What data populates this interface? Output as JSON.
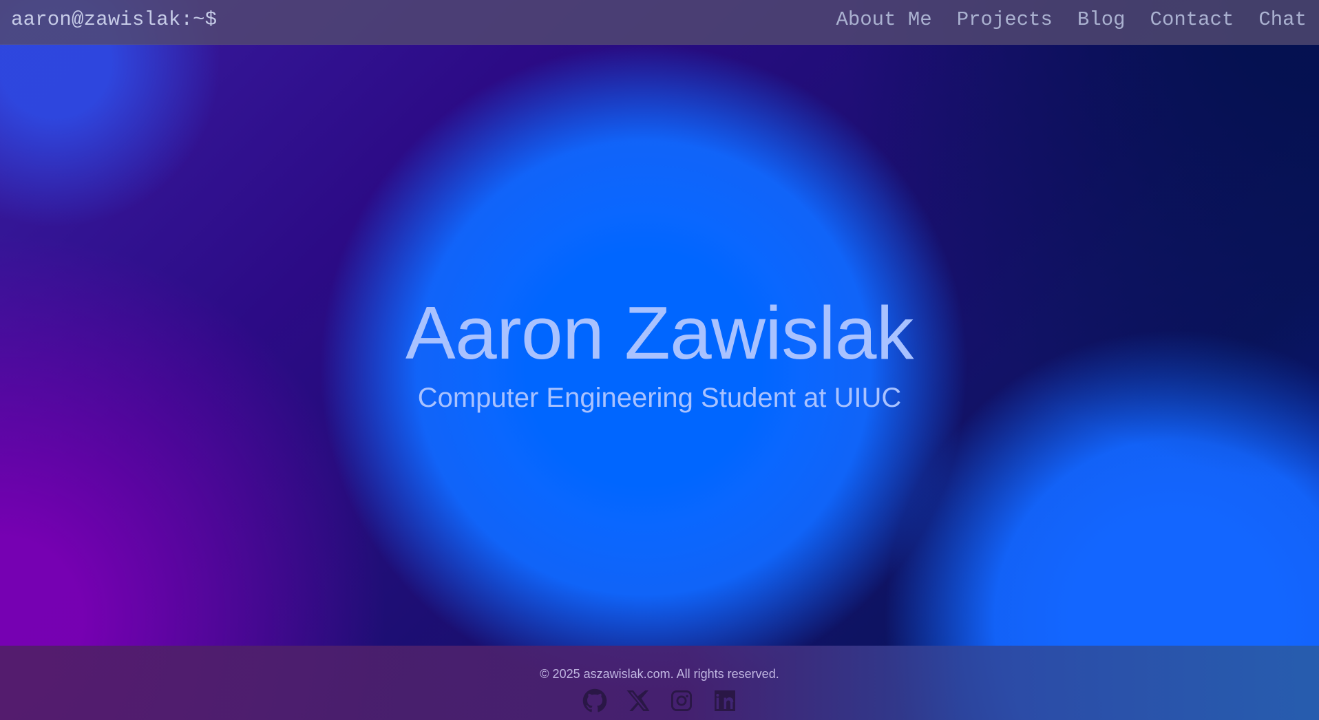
{
  "header": {
    "prompt": "aaron@zawislak:~$",
    "nav": [
      {
        "label": "About Me"
      },
      {
        "label": "Projects"
      },
      {
        "label": "Blog"
      },
      {
        "label": "Contact"
      },
      {
        "label": "Chat"
      }
    ]
  },
  "hero": {
    "title": "Aaron Zawislak",
    "subtitle": "Computer Engineering Student at UIUC"
  },
  "footer": {
    "copyright": "© 2025 aszawislak.com. All rights reserved.",
    "social_icons": [
      "github-icon",
      "x-icon",
      "instagram-icon",
      "linkedin-icon"
    ]
  },
  "colors": {
    "nav_text": "#aab1d0",
    "hero_text": "#a9c2ff",
    "icon_color": "#2a1746"
  }
}
